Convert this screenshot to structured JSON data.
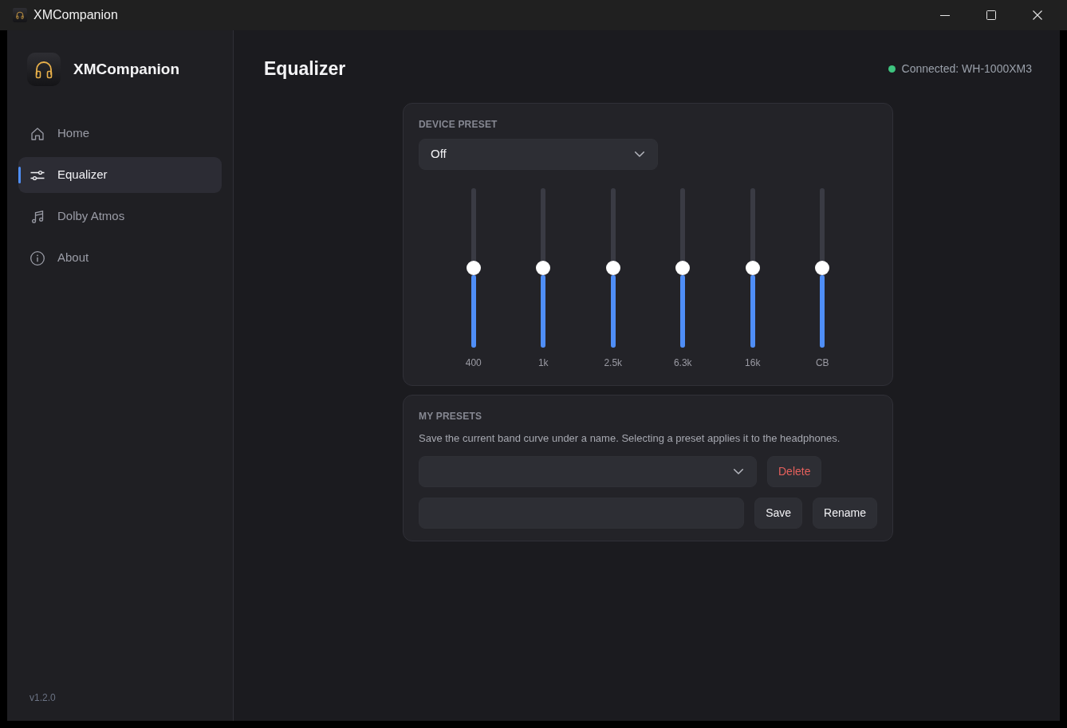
{
  "window": {
    "title": "XMCompanion"
  },
  "sidebar": {
    "app_name": "XMCompanion",
    "items": [
      {
        "label": "Home",
        "selected": false
      },
      {
        "label": "Equalizer",
        "selected": true
      },
      {
        "label": "Dolby Atmos",
        "selected": false
      },
      {
        "label": "About",
        "selected": false
      }
    ],
    "version": "v1.2.0"
  },
  "header": {
    "title": "Equalizer",
    "status": {
      "text": "Connected: WH-1000XM3",
      "connected": true
    }
  },
  "device_preset": {
    "label": "DEVICE PRESET",
    "value": "Off",
    "bands": [
      {
        "label": "400",
        "level": 0.5
      },
      {
        "label": "1k",
        "level": 0.5
      },
      {
        "label": "2.5k",
        "level": 0.5
      },
      {
        "label": "6.3k",
        "level": 0.5
      },
      {
        "label": "16k",
        "level": 0.5
      },
      {
        "label": "CB",
        "level": 0.5
      }
    ]
  },
  "my_presets": {
    "label": "MY PRESETS",
    "description": "Save the current band curve under a name. Selecting a preset applies it to the headphones.",
    "select_actions": [
      {
        "label": "Delete",
        "kind": "danger"
      }
    ],
    "name_actions": [
      {
        "label": "Save",
        "kind": "default"
      },
      {
        "label": "Rename",
        "kind": "default"
      }
    ]
  }
}
